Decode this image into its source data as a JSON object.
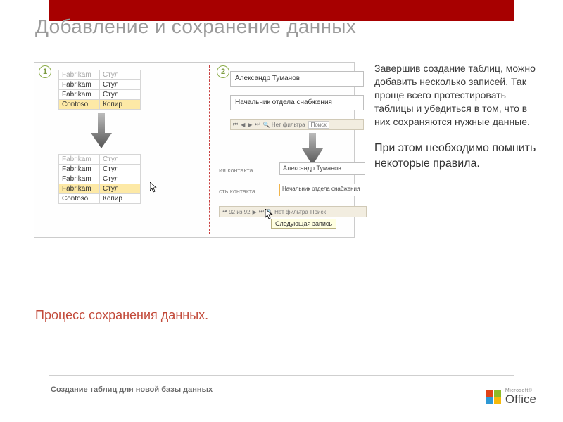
{
  "title": "Добавление и сохранение данных",
  "badges": {
    "one": "1",
    "two": "2"
  },
  "table": {
    "headers": [
      "Fabrikam",
      "Стул"
    ],
    "rows1": [
      [
        "Fabrikam",
        "Стул"
      ],
      [
        "Fabrikam",
        "Стул"
      ],
      [
        "Contoso",
        "Копир"
      ]
    ],
    "rows2": [
      [
        "Fabrikam",
        "Стул"
      ],
      [
        "Fabrikam",
        "Стул"
      ],
      [
        "Fabrikam",
        "Стул"
      ],
      [
        "Contoso",
        "Копир"
      ]
    ]
  },
  "form": {
    "name": "Александр Туманов",
    "title": "Начальник отдела снабжения",
    "lblA": "ия контакта",
    "lblB": "сть контакта",
    "valA": "Александр Туманов",
    "valB": "Начальник отдела снабжения"
  },
  "nav": {
    "nofilter": "Нет фильтра",
    "search": "Поиск",
    "record": "92 из 92",
    "tooltip": "Следующая запись"
  },
  "right": {
    "p1": "Завершив создание таблиц, можно добавить несколько записей. Так проще всего протестировать таблицы и убедиться в том, что в них сохраняются нужные данные.",
    "p2": "При этом необходимо помнить некоторые правила."
  },
  "process": "Процесс сохранения данных.",
  "footer": "Создание таблиц для новой базы данных",
  "logo": {
    "ms": "Microsoft®",
    "office": "Office"
  }
}
